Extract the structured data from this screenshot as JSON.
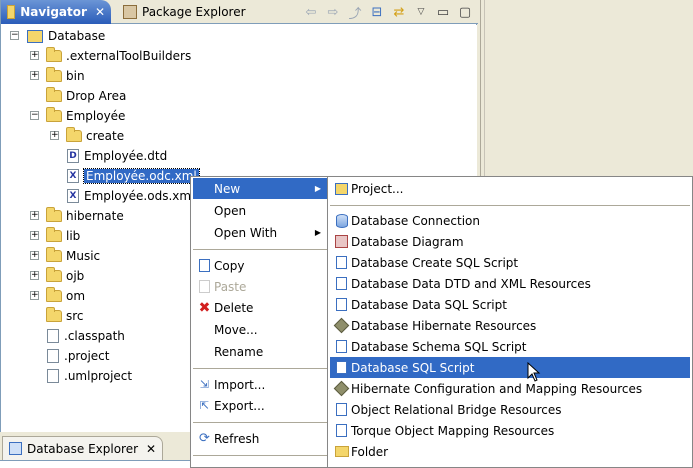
{
  "navigator": {
    "tab_title": "Navigator",
    "other_tab": "Package Explorer"
  },
  "tree": [
    {
      "label": "Database",
      "icon": "project-icon",
      "expander": "−"
    },
    {
      "label": ".externalToolBuilders",
      "icon": "folder-icon",
      "expander": "+"
    },
    {
      "label": "bin",
      "icon": "folder-icon",
      "expander": "+"
    },
    {
      "label": "Drop Area",
      "icon": "folder-icon",
      "expander": ""
    },
    {
      "label": "Employée",
      "icon": "folder-icon",
      "expander": "−"
    },
    {
      "label": "create",
      "icon": "folder-icon",
      "expander": "+"
    },
    {
      "label": "Employée.dtd",
      "icon": "dtd-file-icon",
      "expander": ""
    },
    {
      "label": "Employée.odc.xml",
      "icon": "xml-file-icon",
      "expander": ""
    },
    {
      "label": "Employée.ods.xml",
      "icon": "xml-file-icon",
      "expander": ""
    },
    {
      "label": "hibernate",
      "icon": "folder-icon",
      "expander": "+"
    },
    {
      "label": "lib",
      "icon": "folder-icon",
      "expander": "+"
    },
    {
      "label": "Music",
      "icon": "folder-icon",
      "expander": "+"
    },
    {
      "label": "ojb",
      "icon": "folder-icon",
      "expander": "+"
    },
    {
      "label": "om",
      "icon": "folder-icon",
      "expander": "+"
    },
    {
      "label": "src",
      "icon": "folder-icon",
      "expander": ""
    },
    {
      "label": ".classpath",
      "icon": "file-icon",
      "expander": ""
    },
    {
      "label": ".project",
      "icon": "file-icon",
      "expander": ""
    },
    {
      "label": ".umlproject",
      "icon": "file-icon",
      "expander": ""
    }
  ],
  "context_menu": {
    "new": "New",
    "open": "Open",
    "open_with": "Open With",
    "copy": "Copy",
    "paste": "Paste",
    "delete": "Delete",
    "move": "Move...",
    "rename": "Rename",
    "import": "Import...",
    "export": "Export...",
    "refresh": "Refresh"
  },
  "submenu": {
    "project": "Project...",
    "items": [
      "Database Connection",
      "Database Diagram",
      "Database Create SQL Script",
      "Database Data DTD and XML Resources",
      "Database Data SQL Script",
      "Database Hibernate Resources",
      "Database Schema SQL Script",
      "Database SQL Script",
      "Hibernate Configuration and Mapping Resources",
      "Object Relational Bridge Resources",
      "Torque Object Mapping Resources",
      "Folder"
    ],
    "highlighted_index": 7
  },
  "bottom_view": {
    "tab_title": "Database Explorer"
  },
  "colors": {
    "selection": "#316ac5",
    "active_tab": "#2a5cb9"
  }
}
